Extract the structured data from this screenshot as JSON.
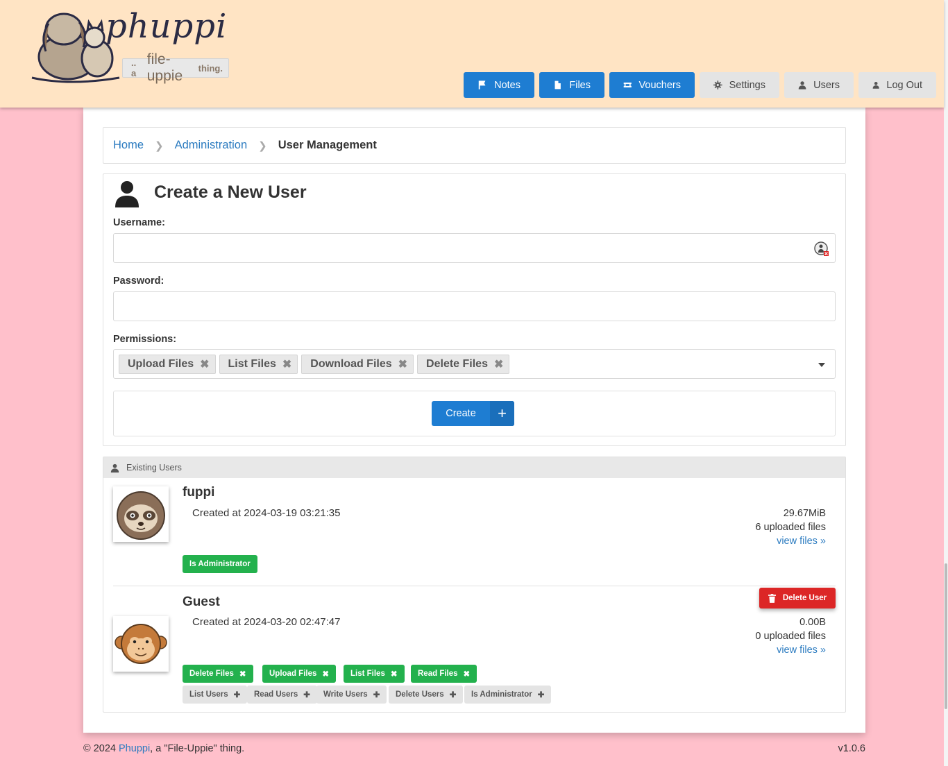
{
  "brand": {
    "name": "phuppi",
    "tagline_prefix": ".. a",
    "tagline_main": "file-uppie",
    "tagline_suffix": "thing."
  },
  "nav": [
    {
      "label": "Notes",
      "icon": "flag-icon",
      "style": "blue"
    },
    {
      "label": "Files",
      "icon": "file-icon",
      "style": "blue"
    },
    {
      "label": "Vouchers",
      "icon": "ticket-icon",
      "style": "blue"
    },
    {
      "label": "Settings",
      "icon": "gear-icon",
      "style": "grey"
    },
    {
      "label": "Users",
      "icon": "user-icon",
      "style": "grey"
    },
    {
      "label": "Log Out",
      "icon": "user-icon",
      "style": "grey"
    }
  ],
  "breadcrumb": {
    "home": "Home",
    "admin": "Administration",
    "current": "User Management"
  },
  "create_form": {
    "title": "Create a New User",
    "username_label": "Username:",
    "username_value": "",
    "password_label": "Password:",
    "password_value": "",
    "permissions_label": "Permissions:",
    "permission_tags": [
      "Upload Files",
      "List Files",
      "Download Files",
      "Delete Files"
    ],
    "create_label": "Create"
  },
  "existing_users": {
    "header": "Existing Users",
    "users": [
      {
        "name": "fuppi",
        "created": "Created at 2024-03-19 03:21:35",
        "size": "29.67MiB",
        "files": "6 uploaded files",
        "view": "view files »",
        "granted": [
          "Is Administrator"
        ],
        "available": []
      },
      {
        "name": "Guest",
        "created": "Created at 2024-03-20 02:47:47",
        "size": "0.00B",
        "files": "0 uploaded files",
        "view": "view files »",
        "delete_label": "Delete User",
        "granted": [
          "Delete Files",
          "Upload Files",
          "List Files",
          "Read Files"
        ],
        "available": [
          "List Users",
          "Read Users",
          "Write Users",
          "Delete Users",
          "Is Administrator"
        ]
      }
    ]
  },
  "footer": {
    "copyright": "© 2024",
    "link": "Phuppi",
    "rest": ", a \"File-Uppie\" thing.",
    "version": "v1.0.6"
  },
  "colors": {
    "header_bg": "#ffe4c4",
    "page_bg": "#ffc0cb",
    "primary": "#1e7dd2",
    "success": "#23b14d",
    "danger": "#dc2626"
  }
}
